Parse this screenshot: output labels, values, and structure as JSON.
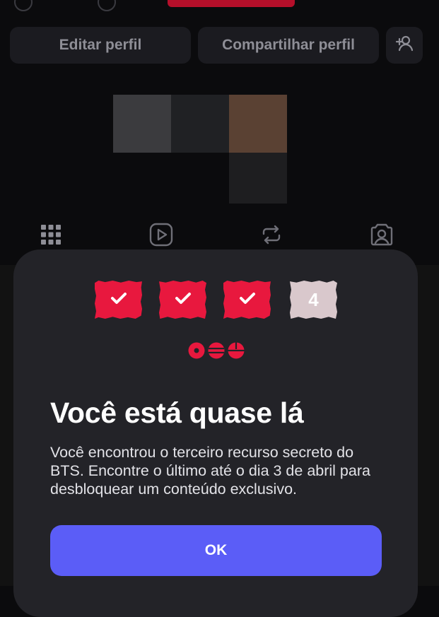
{
  "profile_actions": {
    "edit_label": "Editar perfil",
    "share_label": "Compartilhar perfil"
  },
  "tabs": [
    "grid-icon",
    "reels-icon",
    "reposts-icon",
    "tagged-icon"
  ],
  "modal": {
    "stamps": [
      {
        "state": "done",
        "icon": "check-icon"
      },
      {
        "state": "done",
        "icon": "check-icon"
      },
      {
        "state": "done",
        "icon": "check-icon"
      },
      {
        "state": "pending",
        "label": "4"
      }
    ],
    "title": "Você está quase lá",
    "description": "Você encontrou o terceiro recurso secreto do BTS. Encontre o último até o dia 3 de abril para desbloquear um conteúdo exclusivo.",
    "ok_label": "OK"
  },
  "colors": {
    "accent_red": "#e8183e",
    "button_blue": "#5b5df7",
    "sheet_bg": "#232328"
  }
}
